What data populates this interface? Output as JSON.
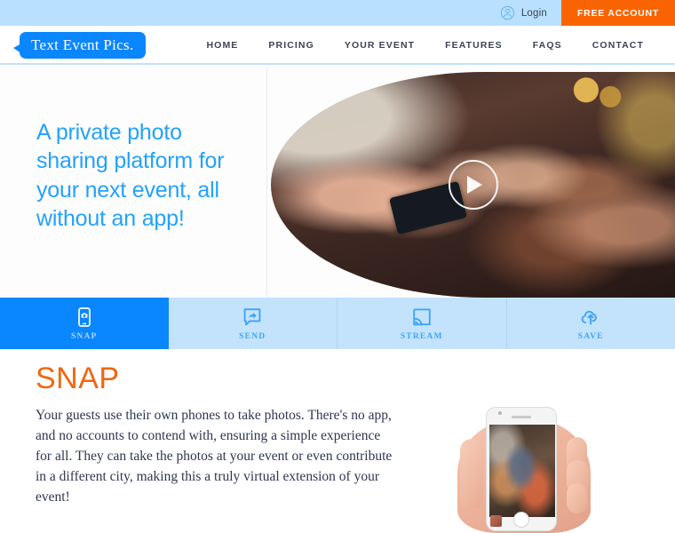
{
  "utility_bar": {
    "login_label": "Login",
    "login_icon": "user-circle-icon",
    "free_account_label": "FREE ACCOUNT",
    "background_color": "#b9e0ff",
    "accent_color": "#fa6400"
  },
  "nav": {
    "logo_text": "Text Event Pics.",
    "logo_color": "#0a86ff",
    "links": [
      {
        "label": "HOME"
      },
      {
        "label": "PRICING"
      },
      {
        "label": "YOUR EVENT"
      },
      {
        "label": "FEATURES"
      },
      {
        "label": "FAQS"
      },
      {
        "label": "CONTACT"
      }
    ]
  },
  "hero": {
    "headline": "A private photo sharing platform for your next event, all without an app!",
    "headline_color": "#22a2fb",
    "media_alt": "Group of friends taking a selfie at a party with gold balloons",
    "play_button_label": "play-video"
  },
  "tabs": [
    {
      "label": "SNAP",
      "icon": "phone-camera-icon",
      "active": true
    },
    {
      "label": "SEND",
      "icon": "message-share-icon",
      "active": false
    },
    {
      "label": "STREAM",
      "icon": "cast-screen-icon",
      "active": false
    },
    {
      "label": "SAVE",
      "icon": "cloud-upload-icon",
      "active": false
    }
  ],
  "section": {
    "title": "SNAP",
    "title_color": "#f2660f",
    "body": "Your guests use their own phones to take photos. There's no app, and no accounts to contend with, ensuring a simple experience for all. They can take the photos at your event or even contribute in a different city, making this a truly virtual extension of your event!",
    "illustration_alt": "Hand holding a white smartphone showing the camera app"
  }
}
